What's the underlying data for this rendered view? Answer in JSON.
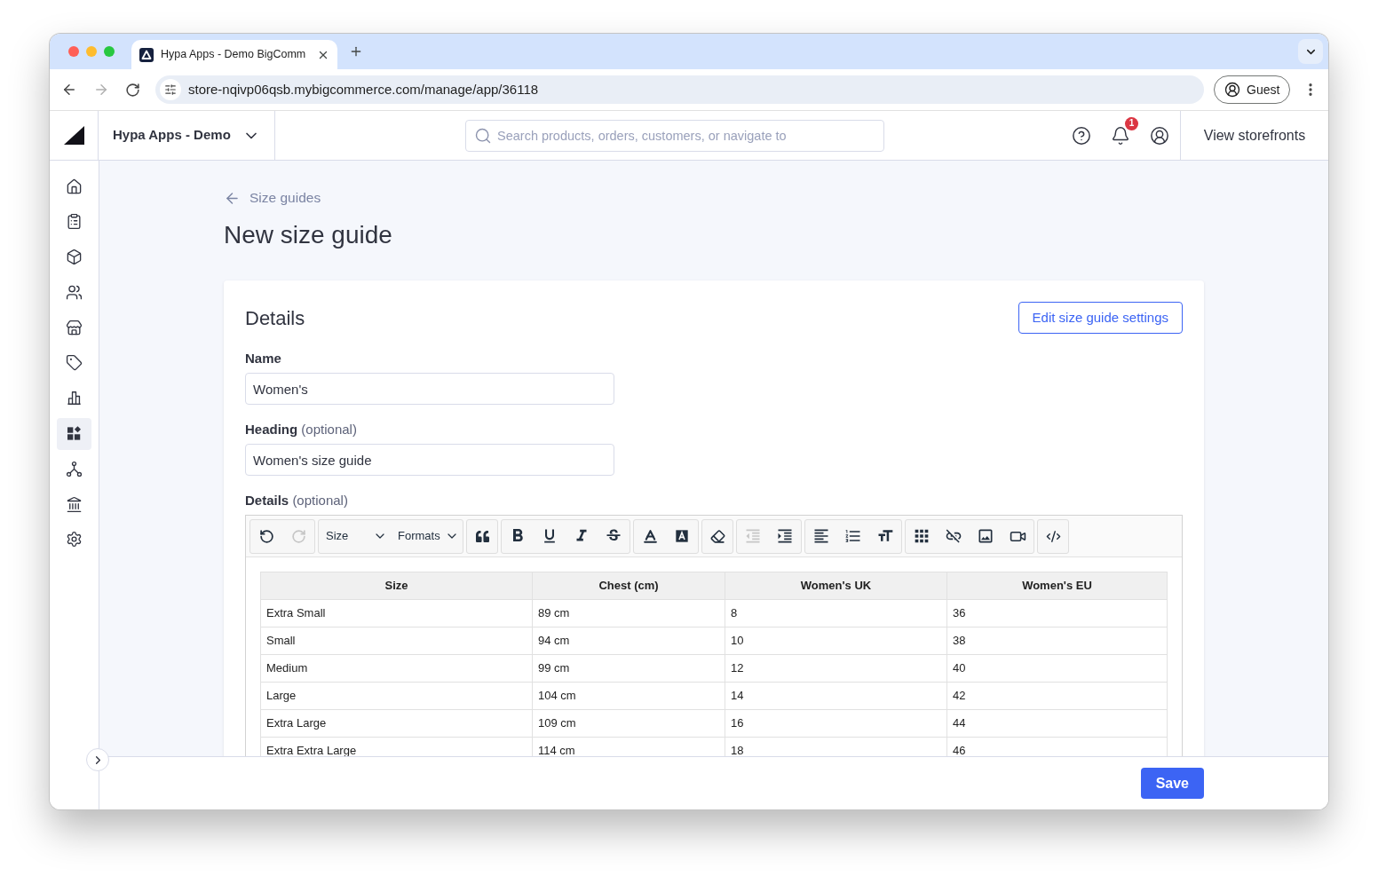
{
  "browser": {
    "tab": {
      "title": "Hypa Apps - Demo BigComm"
    },
    "address": "store-nqivp06qsb.mybigcommerce.com/manage/app/36118",
    "profile": "Guest"
  },
  "header": {
    "store_name": "Hypa Apps - Demo",
    "search": {
      "placeholder": "Search products, orders, customers, or navigate to"
    },
    "notifications": {
      "badge": "1"
    },
    "storefronts_link": "View storefronts"
  },
  "sidebar": {
    "items": [
      {
        "kind": "home",
        "selected": false
      },
      {
        "kind": "orders",
        "selected": false
      },
      {
        "kind": "products",
        "selected": false
      },
      {
        "kind": "customers",
        "selected": false
      },
      {
        "kind": "storefront",
        "selected": false
      },
      {
        "kind": "marketing",
        "selected": false
      },
      {
        "kind": "analytics",
        "selected": false
      },
      {
        "kind": "apps",
        "selected": true
      },
      {
        "kind": "channels",
        "selected": false
      },
      {
        "kind": "finance",
        "selected": false
      },
      {
        "kind": "settings",
        "selected": false
      }
    ]
  },
  "page": {
    "back_link": "Size guides",
    "title": "New size guide"
  },
  "card": {
    "title": "Details",
    "settings_button": "Edit size guide settings",
    "fields": [
      {
        "label": "Name",
        "value": "Women's"
      },
      {
        "label": "Heading",
        "hint": "(optional)",
        "value": "Women's size guide"
      }
    ],
    "editor": {
      "label": "Details",
      "hint": "(optional)",
      "toolbar": [
        {
          "buttons": [
            {
              "kind": "undo",
              "disabled": false
            },
            {
              "kind": "redo",
              "disabled": true
            }
          ]
        },
        {
          "buttons": [
            {
              "kind": "dropdown",
              "label": "Size",
              "disabled": false
            },
            {
              "kind": "dropdown",
              "label": "Formats",
              "disabled": false
            }
          ]
        },
        {
          "buttons": [
            {
              "kind": "blockquote",
              "disabled": false
            }
          ]
        },
        {
          "buttons": [
            {
              "kind": "bold",
              "disabled": false
            },
            {
              "kind": "underline",
              "disabled": false
            },
            {
              "kind": "italic",
              "disabled": false
            },
            {
              "kind": "strikethrough",
              "disabled": false
            }
          ]
        },
        {
          "buttons": [
            {
              "kind": "text_color",
              "disabled": false
            },
            {
              "kind": "background_color",
              "disabled": false
            }
          ]
        },
        {
          "buttons": [
            {
              "kind": "clear_formatting",
              "disabled": false
            }
          ]
        },
        {
          "buttons": [
            {
              "kind": "outdent",
              "disabled": true
            },
            {
              "kind": "indent",
              "disabled": false
            }
          ]
        },
        {
          "buttons": [
            {
              "kind": "align_left",
              "disabled": false
            },
            {
              "kind": "numbered_list",
              "disabled": false
            },
            {
              "kind": "line_height",
              "disabled": false
            }
          ]
        },
        {
          "buttons": [
            {
              "kind": "table",
              "disabled": false
            },
            {
              "kind": "unlink",
              "disabled": false
            },
            {
              "kind": "image",
              "disabled": false
            },
            {
              "kind": "video",
              "disabled": false
            }
          ]
        },
        {
          "buttons": [
            {
              "kind": "source_code",
              "disabled": false
            }
          ]
        }
      ],
      "table": {
        "columns": [
          "Size",
          "Chest (cm)",
          "Women's UK",
          "Women's EU"
        ],
        "rows": [
          [
            "Extra Small",
            "89 cm",
            "8",
            "36"
          ],
          [
            "Small",
            "94 cm",
            "10",
            "38"
          ],
          [
            "Medium",
            "99 cm",
            "12",
            "40"
          ],
          [
            "Large",
            "104 cm",
            "14",
            "42"
          ],
          [
            "Extra Large",
            "109 cm",
            "16",
            "44"
          ],
          [
            "Extra Extra Large",
            "114 cm",
            "18",
            "46"
          ]
        ]
      }
    }
  },
  "footer": {
    "save_button": "Save"
  }
}
